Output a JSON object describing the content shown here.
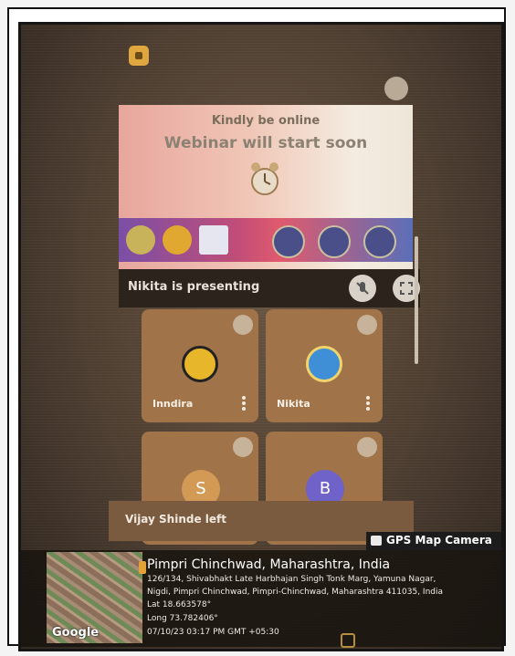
{
  "slide": {
    "line1": "Kindly be online",
    "line2": "Webinar will start soon",
    "icon": "alarm-clock-icon"
  },
  "presenter": {
    "text": "Nikita is presenting",
    "mic_icon": "microphone-muted-icon",
    "fullscreen_icon": "fullscreen-icon"
  },
  "participants": [
    {
      "name": "Inndira",
      "avatar": "logo"
    },
    {
      "name": "Nikita",
      "avatar": "logo"
    },
    {
      "initial": "S",
      "color": "#d29a54"
    },
    {
      "initial": "B",
      "color": "#6f63c9"
    }
  ],
  "notification": {
    "text": "Vijay Shinde left"
  },
  "gps": {
    "tag": "GPS Map Camera",
    "city": "Pimpri Chinchwad, Maharashtra, India",
    "address1": "126/134, Shivabhakt Late Harbhajan Singh Tonk Marg, Yamuna Nagar,",
    "address2": "Nigdi, Pimpri Chinchwad, Pimpri-Chinchwad, Maharashtra 411035, India",
    "lat": "Lat 18.663578°",
    "long": "Long 73.782406°",
    "datetime": "07/10/23 03:17 PM GMT +05:30",
    "map_credit": "Google"
  }
}
